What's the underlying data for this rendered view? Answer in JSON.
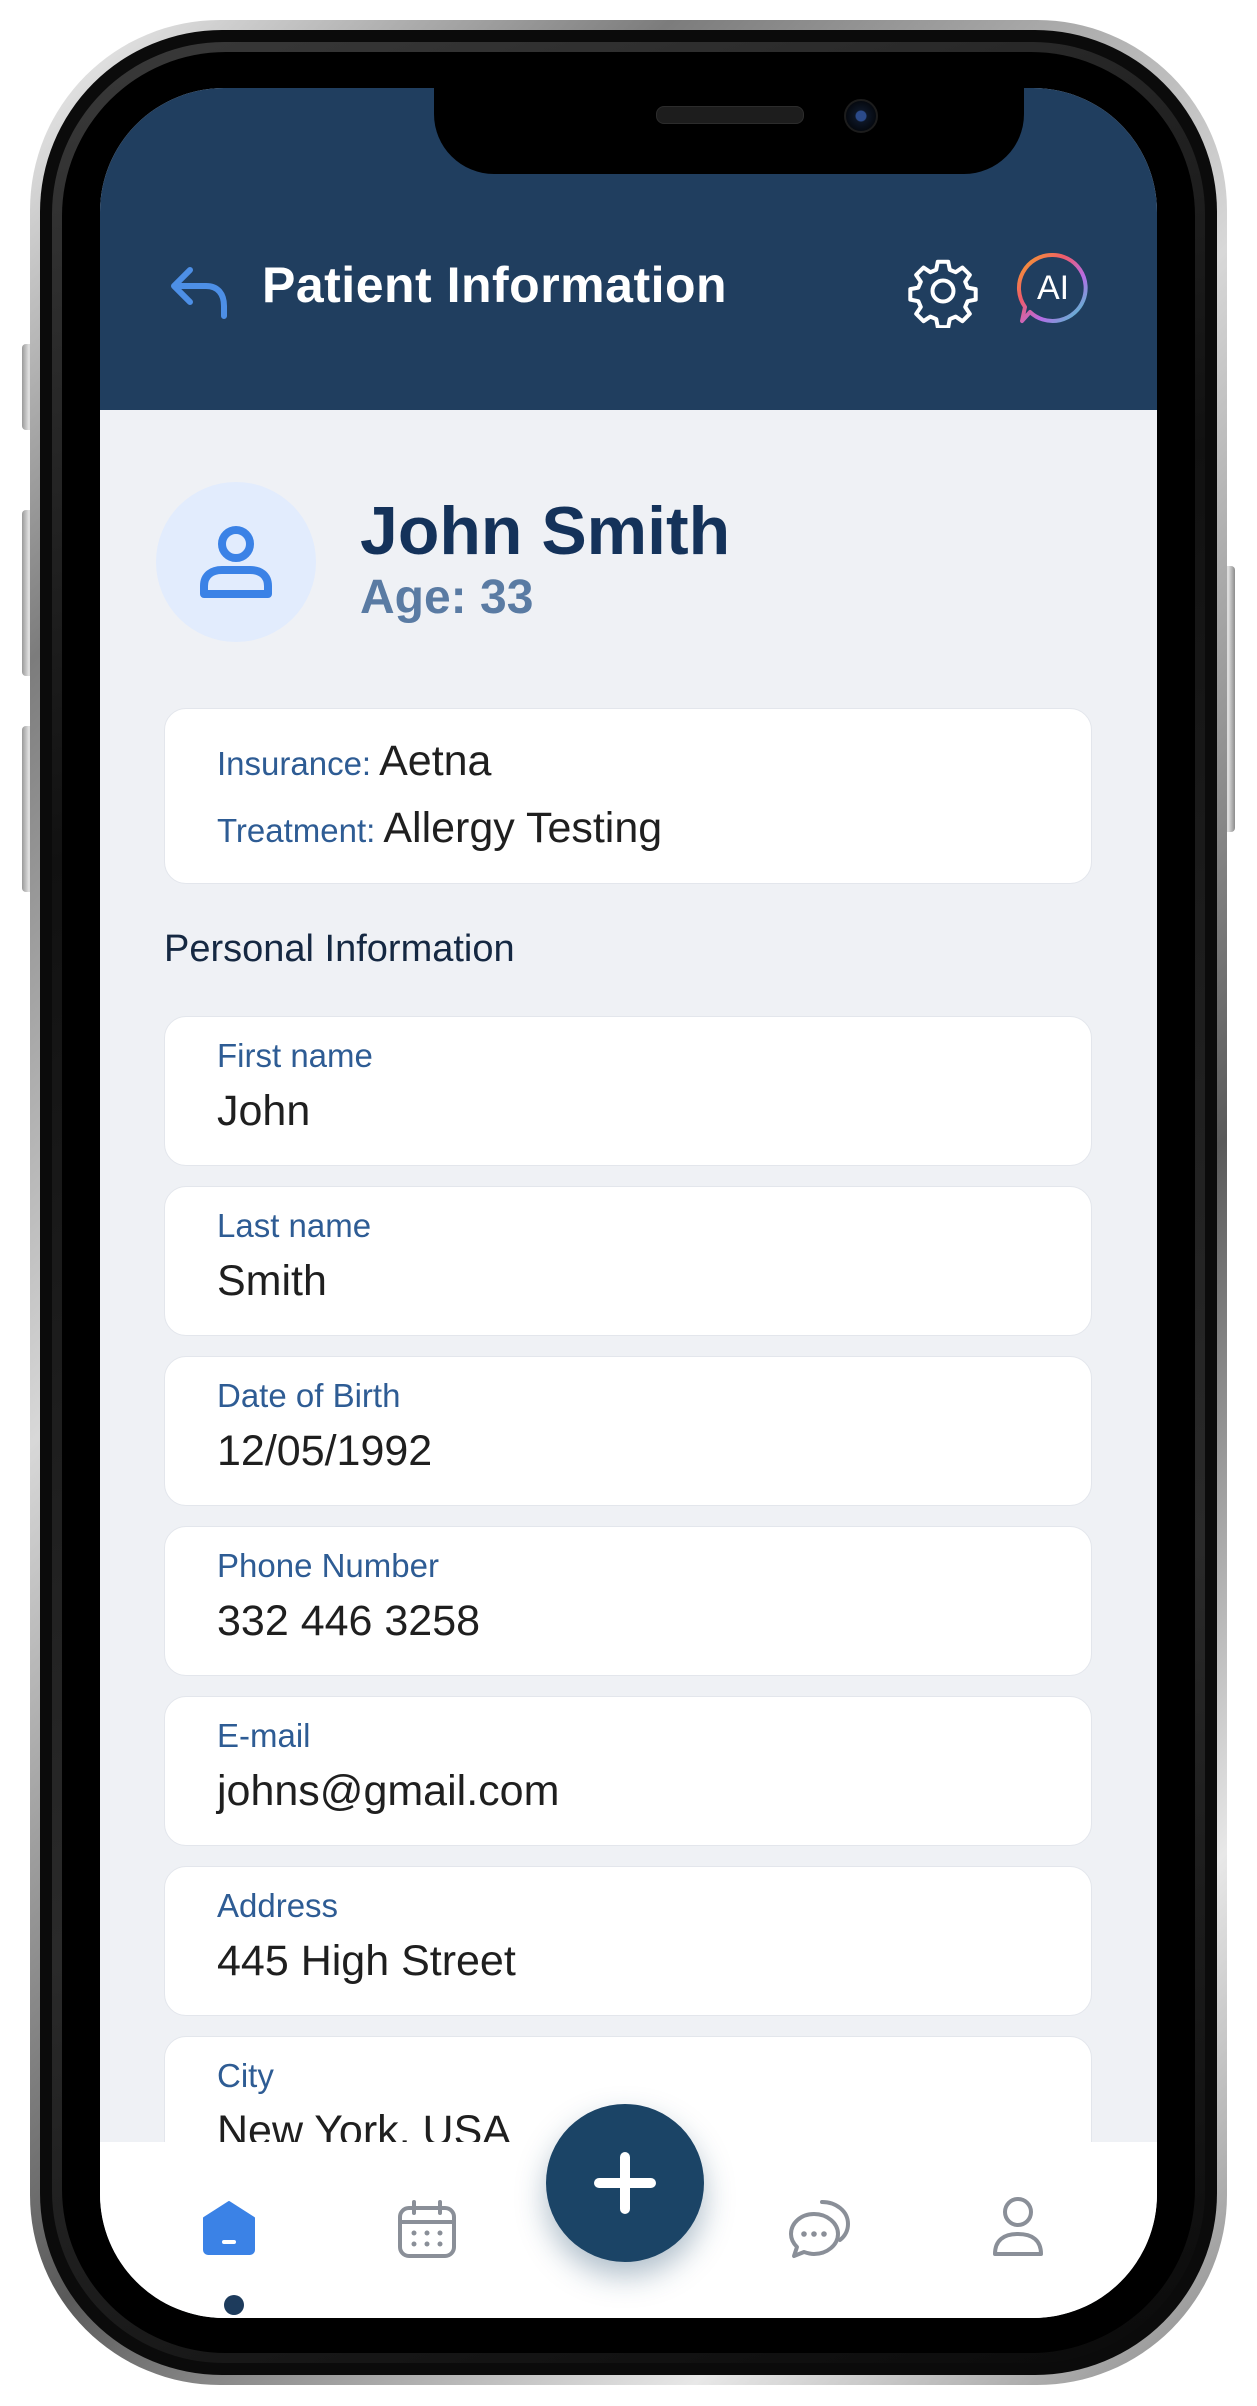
{
  "header": {
    "title": "Patient Information",
    "ai_label": "AI"
  },
  "patient": {
    "name": "John Smith",
    "age_label": "Age: 33"
  },
  "summary": {
    "insurance_label": "Insurance:",
    "insurance_value": "Aetna",
    "treatment_label": "Treatment:",
    "treatment_value": "Allergy Testing"
  },
  "section_title": "Personal Information",
  "fields": [
    {
      "label": "First name",
      "value": "John"
    },
    {
      "label": "Last name",
      "value": "Smith"
    },
    {
      "label": "Date of Birth",
      "value": "12/05/1992"
    },
    {
      "label": "Phone Number",
      "value": "332 446 3258"
    },
    {
      "label": "E-mail",
      "value": "johns@gmail.com"
    },
    {
      "label": "Address",
      "value": "445 High Street"
    },
    {
      "label": "City",
      "value": "New York, USA"
    }
  ],
  "nav": {
    "items": [
      "home-icon",
      "calendar-icon",
      "add-icon",
      "chat-icon",
      "profile-icon"
    ],
    "active": "home"
  },
  "colors": {
    "header_bg": "#203e5f",
    "accent_blue": "#3b82e6",
    "label_blue": "#2e5c94",
    "fab_bg": "#1b4466"
  }
}
